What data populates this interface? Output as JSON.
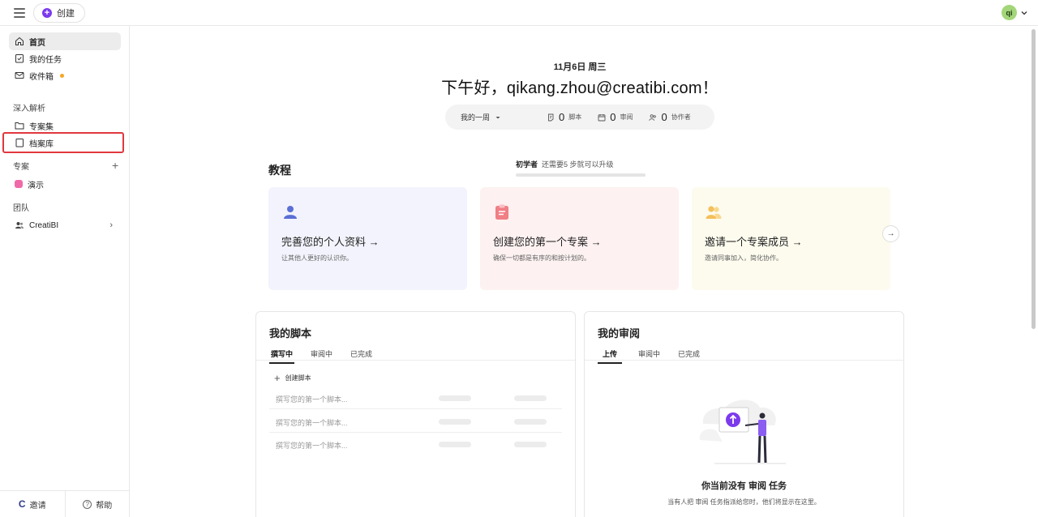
{
  "topbar": {
    "create_label": "创建",
    "avatar_initials": "qi"
  },
  "sidebar": {
    "nav": [
      {
        "label": "首页",
        "icon": "home-icon"
      },
      {
        "label": "我的任务",
        "icon": "clipboard-check-icon"
      },
      {
        "label": "收件箱",
        "icon": "mail-icon"
      }
    ],
    "insights_label": "深入解析",
    "insights": [
      {
        "label": "专案集",
        "icon": "folder-icon"
      },
      {
        "label": "档案库",
        "icon": "book-icon"
      }
    ],
    "projects_label": "专案",
    "projects": [
      {
        "label": "演示",
        "color": "#f06aa9"
      }
    ],
    "team_label": "团队",
    "team": [
      {
        "label": "CreatiBI",
        "icon": "people-icon"
      }
    ],
    "footer": {
      "invite_label": "邀请",
      "help_label": "帮助"
    }
  },
  "main": {
    "date": "11月6日 周三",
    "greeting": "下午好，qikang.zhou@creatibi.com！",
    "stats": {
      "period": "我的一周",
      "items": [
        {
          "value": "0",
          "label": "脚本",
          "icon": "script-icon"
        },
        {
          "value": "0",
          "label": "审阅",
          "icon": "calendar-review-icon"
        },
        {
          "value": "0",
          "label": "协作者",
          "icon": "collaborators-icon"
        }
      ]
    },
    "tutorial": {
      "title": "教程",
      "level": "初学者",
      "level_hint": "还需要5 步就可以升级",
      "progress": 0,
      "cards": [
        {
          "title": "完善您的个人资料",
          "desc": "让其他人更好的认识你。",
          "icon": "user-icon",
          "bg": "#f2f3fc"
        },
        {
          "title": "创建您的第一个专案",
          "desc": "确保一切都是有序的和按计划的。",
          "icon": "clipboard-icon",
          "bg": "#fdf1f1"
        },
        {
          "title": "邀请一个专案成员",
          "desc": "邀请同事加入，简化协作。",
          "icon": "team-icon",
          "bg": "#fdfbee"
        }
      ]
    },
    "scripts_panel": {
      "title": "我的脚本",
      "tabs": [
        "撰写中",
        "审阅中",
        "已完成"
      ],
      "active_tab": 0,
      "create_label": "创建脚本",
      "rows": [
        "撰写您的第一个脚本...",
        "撰写您的第一个脚本...",
        "撰写您的第一个脚本..."
      ]
    },
    "reviews_panel": {
      "title": "我的审阅",
      "tabs": [
        "上传",
        "审阅中",
        "已完成"
      ],
      "active_tab": 0,
      "empty_title": "你当前没有 审阅 任务",
      "empty_desc": "当有人把 审阅 任务指派给您时，他们将显示在这里。"
    }
  },
  "colors": {
    "accent": "#7c3aed",
    "highlight": "#e0383e",
    "badge": "#f5a623"
  }
}
